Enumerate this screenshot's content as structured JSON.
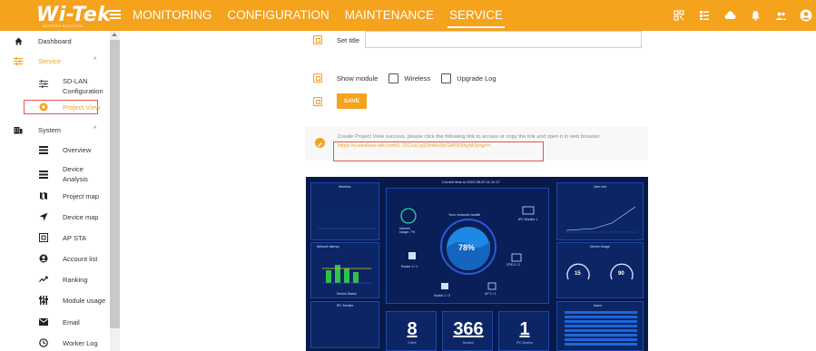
{
  "brand": {
    "logo": "Wi-Tek",
    "tagline": "NETWORK SOLUTIONS"
  },
  "nav": [
    "MONITORING",
    "CONFIGURATION",
    "MAINTENANCE",
    "SERVICE"
  ],
  "nav_active": "SERVICE",
  "toolbar_icons": [
    "qr-code-icon",
    "list-icon",
    "cloud-icon",
    "bell-icon",
    "users-icon",
    "user-icon"
  ],
  "sidebar": {
    "dashboard": "Dashboard",
    "service": "Service",
    "sdlan": "SD-LAN Configuration",
    "project_view": "Project View",
    "system": "System",
    "items": [
      {
        "label": "Overview",
        "icon": "overview-icon"
      },
      {
        "label": "Device Analysis",
        "icon": "device-analysis-icon"
      },
      {
        "label": "Project map",
        "icon": "project-map-icon"
      },
      {
        "label": "Device map",
        "icon": "device-map-icon"
      },
      {
        "label": "AP STA",
        "icon": "ap-sta-icon"
      },
      {
        "label": "Account list",
        "icon": "account-list-icon"
      },
      {
        "label": "Ranking",
        "icon": "ranking-icon"
      },
      {
        "label": "Module usage",
        "icon": "module-usage-icon"
      },
      {
        "label": "Email",
        "icon": "email-icon"
      },
      {
        "label": "Worker Log",
        "icon": "worker-log-icon"
      }
    ]
  },
  "form": {
    "set_title_label": "Set title",
    "set_title_value": "",
    "show_module_label": "Show module",
    "module_wireless": "Wireless",
    "module_upgrade_log": "Upgrade Log",
    "save_label": "SAVE"
  },
  "notice": {
    "message": "Create Project View success, please click the following link to access or copy the link and open it in web browser.",
    "link": "https://v.wireless-tek.com/L J1Cce1q32mMu9zGM0Z9hyMJyng=="
  },
  "preview": {
    "header": "Current time is 2022-08-20 11:11:17",
    "panel_titles": [
      "Wireless",
      "Network latency",
      "Device Status",
      "IPC Monitor",
      "User Info",
      "Device Usage",
      "Alarm"
    ],
    "net_health": "Your network health",
    "health_value": "78%",
    "internet_usage": "Internet Usage: 7%",
    "ipc_monitor": "IPC Monitor 1",
    "router": "Router 1 / 1",
    "cpe": "CPE 0 / 2",
    "switch": "Switch 1 / 3",
    "ap": "AP 1 / 1",
    "gauge_cpu": "15",
    "gauge_mem": "90",
    "bottom_numbers": [
      {
        "value": "8",
        "caption": "Client"
      },
      {
        "value": "366",
        "caption": "Session"
      },
      {
        "value": "1",
        "caption": "IPC Monitor"
      }
    ]
  },
  "colors": {
    "accent": "#f5a21c",
    "dashboard_bg": "#081a4a",
    "highlight_border": "#e45353"
  }
}
